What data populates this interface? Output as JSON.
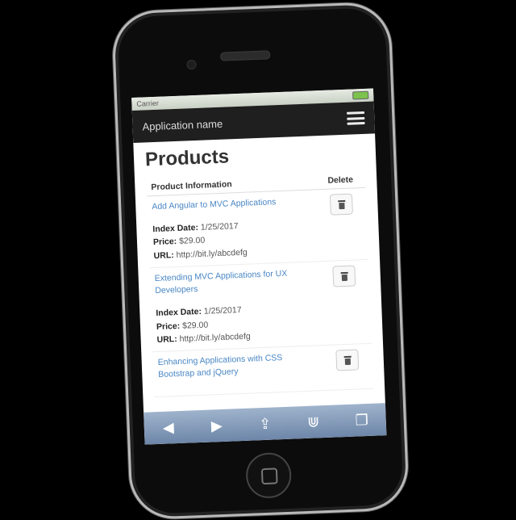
{
  "status_bar": {
    "carrier": "Carrier",
    "time": ""
  },
  "app_bar": {
    "title": "Application name"
  },
  "page": {
    "title": "Products"
  },
  "table": {
    "headers": {
      "info": "Product Information",
      "delete": "Delete"
    },
    "labels": {
      "index_date": "Index Date:",
      "price": "Price:",
      "url": "URL:"
    },
    "rows": [
      {
        "name": "Add Angular to MVC Applications",
        "index_date": "1/25/2017",
        "price": "$29.00",
        "url": "http://bit.ly/abcdefg"
      },
      {
        "name": "Extending MVC Applications for UX Developers",
        "index_date": "1/25/2017",
        "price": "$29.00",
        "url": "http://bit.ly/abcdefg"
      },
      {
        "name": "Enhancing Applications with CSS Bootstrap and jQuery"
      }
    ]
  },
  "safari": {
    "icons": [
      "back-icon",
      "forward-icon",
      "share-icon",
      "bookmarks-icon",
      "tabs-icon"
    ],
    "glyphs": {
      "back": "◀",
      "forward": "▶",
      "share": "⇪",
      "bookmarks": "⋓",
      "tabs": "❐"
    }
  }
}
